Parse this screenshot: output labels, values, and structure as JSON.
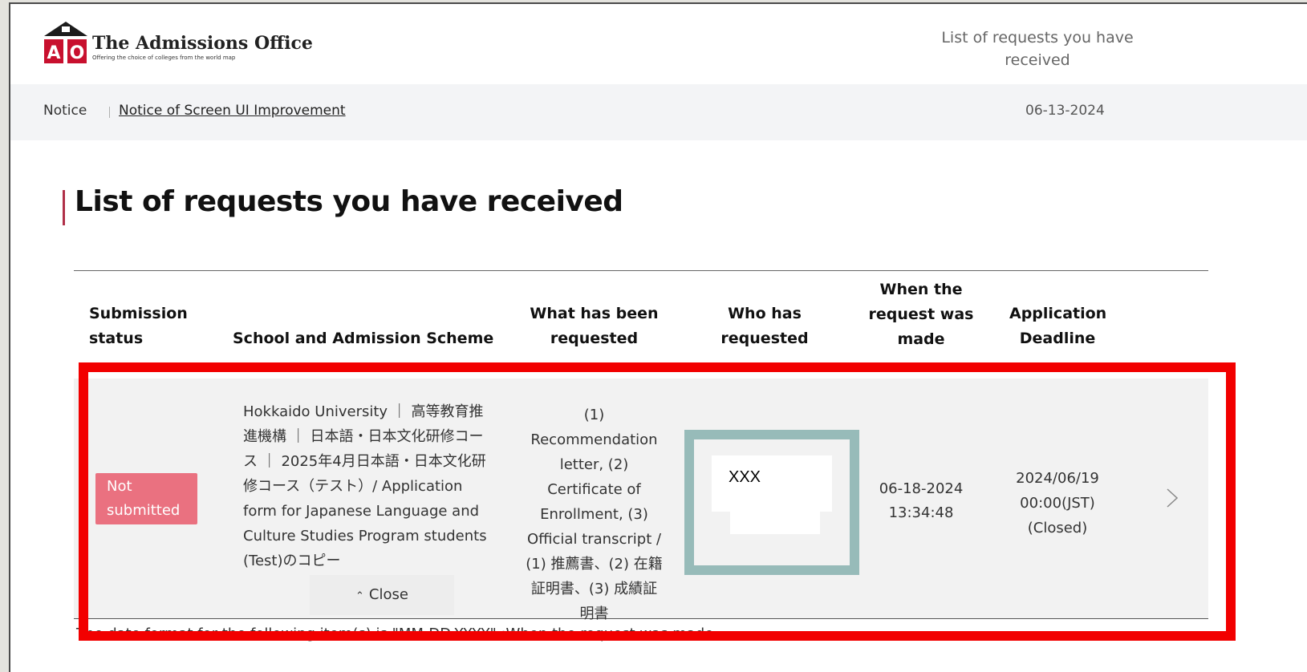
{
  "header": {
    "logo_title": "The Admissions Office",
    "logo_tagline": "Offering the choice of colleges from the world map",
    "logo_letters": [
      "A",
      "O"
    ],
    "nav_link": "List of requests you have received"
  },
  "notice": {
    "label": "Notice",
    "link": "Notice of Screen UI Improvement",
    "date": "06-13-2024"
  },
  "page": {
    "title": "List of requests you have received"
  },
  "table": {
    "columns": {
      "status": "Submission status",
      "school": "School and Admission Scheme",
      "requested": "What has been requested",
      "who": "Who has requested",
      "when": "When the request was made",
      "deadline": "Application Deadline"
    },
    "rows": [
      {
        "status": "Not submitted",
        "school": "Hokkaido University ｜ 高等教育推進機構 ｜ 日本語・日本文化研修コース ｜ 2025年4月日本語・日本文化研修コース（テスト）/ Application form for Japanese Language and Culture Studies Program students (Test)のコピー",
        "close_label": "Close",
        "requested": "(1) Recommendation letter, (2) Certificate of Enrollment, (3) Official transcript / (1) 推薦書、(2) 在籍証明書、(3) 成績証明書",
        "who": "XXX",
        "when_date": "06-18-2024",
        "when_time": "13:34:48",
        "deadline_date": "2024/06/19",
        "deadline_time": "00:00(JST)",
        "deadline_status": "(Closed)"
      }
    ],
    "footnote": "The date format for the following item(s) is \"MM-DD-YYYY\" :When the request was made"
  },
  "colors": {
    "accent": "#b03048",
    "badge": "#ea7180",
    "highlight": "#f20000",
    "redaction_border": "#97bbb9"
  }
}
